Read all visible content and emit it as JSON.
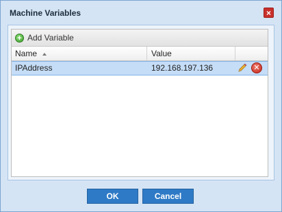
{
  "dialog": {
    "title": "Machine Variables",
    "close_label": "×"
  },
  "toolbar": {
    "add_label": "Add Variable",
    "add_icon": "plus-circle-icon"
  },
  "table": {
    "columns": [
      "Name",
      "Value",
      ""
    ],
    "sort_column": "Name",
    "sort_direction": "ascending",
    "rows": [
      {
        "name": "IPAddress",
        "value": "192.168.197.136",
        "actions": [
          "edit-icon",
          "delete-icon"
        ]
      }
    ]
  },
  "buttons": {
    "ok": "OK",
    "cancel": "Cancel"
  },
  "colors": {
    "dialog_bg": "#d4e4f5",
    "button": "#2e7ac6",
    "selected_row": "#c5ddf7",
    "close": "#c8302c"
  }
}
